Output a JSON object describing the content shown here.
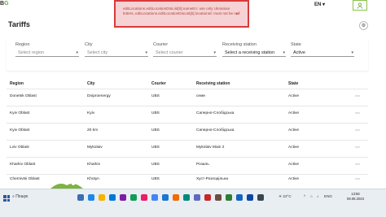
{
  "header": {
    "logo_prefix": "B",
    "logo_accent": "G",
    "language": "EN",
    "user_icon": "user-icon"
  },
  "alert": {
    "message": "editLocations.editLocationDtoList[0].nameEn: use only Ukrainian letters, editLocations.editLocationDtoList[0].locationId: must not be null",
    "close": "×"
  },
  "page": {
    "title": "Tariffs",
    "settings_icon": "gear-icon"
  },
  "filters": [
    {
      "label": "Region",
      "value": "Select region"
    },
    {
      "label": "City",
      "value": "Select city"
    },
    {
      "label": "Courier",
      "value": "Select courier"
    },
    {
      "label": "Receiving station",
      "value": "Select a receiving station"
    },
    {
      "label": "State",
      "value": "Active"
    }
  ],
  "table": {
    "headers": [
      "Region",
      "City",
      "Courier",
      "Receiving station",
      "State"
    ],
    "rows": [
      {
        "region": "Donetsk Oblast",
        "city": "Dniproenergy",
        "courier": "UBS",
        "station": "семе",
        "state": "Active"
      },
      {
        "region": "Kyiv Oblast",
        "city": "Kyiv",
        "courier": "UBS",
        "station": "Саперно-Слобідська",
        "state": "Active"
      },
      {
        "region": "Kyiv Oblast",
        "city": "20 km",
        "courier": "UBS",
        "station": "Саперно-Слобідська",
        "state": "Active"
      },
      {
        "region": "Lviv Oblast",
        "city": "Mykolaiv",
        "courier": "UBS",
        "station": "Mykolaiv Main 2",
        "state": "Active"
      },
      {
        "region": "Kharkiv Oblast",
        "city": "Kharkiv",
        "courier": "UBS",
        "station": "Розаль",
        "state": "Active"
      },
      {
        "region": "Chernivtsi Oblast",
        "city": "Khotyn",
        "courier": "UBS",
        "station": "Хуст-Розподільна",
        "state": "Active"
      }
    ],
    "row_menu": "⋯"
  },
  "taskbar": {
    "search": "Пошук",
    "weather": "22°C",
    "language": "ENG",
    "time": "13:56",
    "date": "08.06.2023"
  }
}
